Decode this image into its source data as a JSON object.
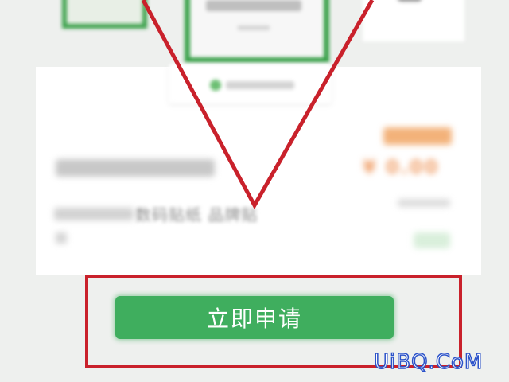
{
  "product": {
    "subtitle_visible": "数码贴纸 品牌贴",
    "price": "¥ 0.00"
  },
  "apply_button": {
    "label": "立即申请"
  },
  "annotation": {
    "color": "#c9212b"
  },
  "watermark": {
    "text": "UiBQ.CoM"
  },
  "colors": {
    "brand_green": "#3fae5e",
    "price_orange": "#f0a06a"
  }
}
